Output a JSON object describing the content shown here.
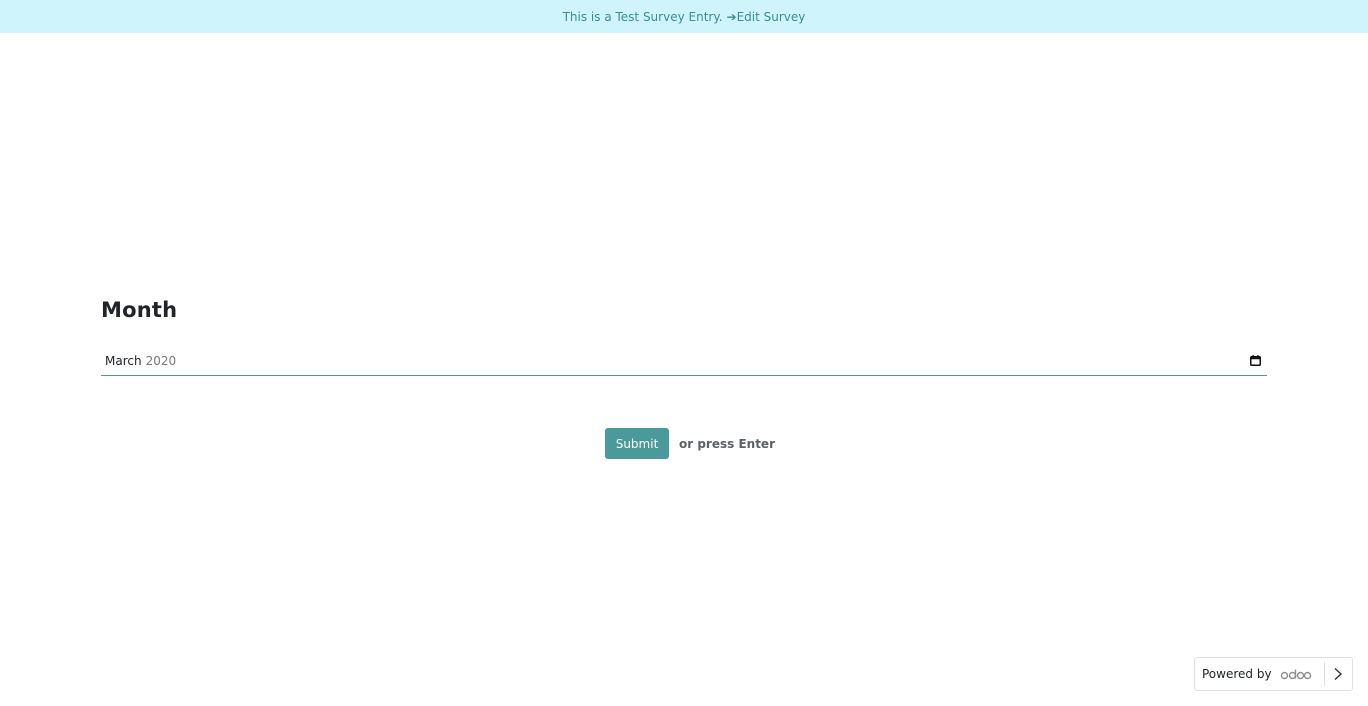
{
  "banner": {
    "text": "This is a Test Survey Entry.",
    "arrow": "➔",
    "edit_link": "Edit Survey"
  },
  "question": {
    "title": "Month",
    "value_month": "March",
    "value_year": "2020"
  },
  "actions": {
    "submit_label": "Submit",
    "hint": "or press Enter"
  },
  "footer": {
    "powered_by": "Powered by",
    "logo_text": "odoo"
  },
  "colors": {
    "banner_bg": "#cff4fc",
    "accent": "#4a9a9b",
    "banner_text": "#3a8c95"
  },
  "icons": [
    "calendar-icon",
    "chevron-right-icon",
    "arrow-right-icon"
  ]
}
